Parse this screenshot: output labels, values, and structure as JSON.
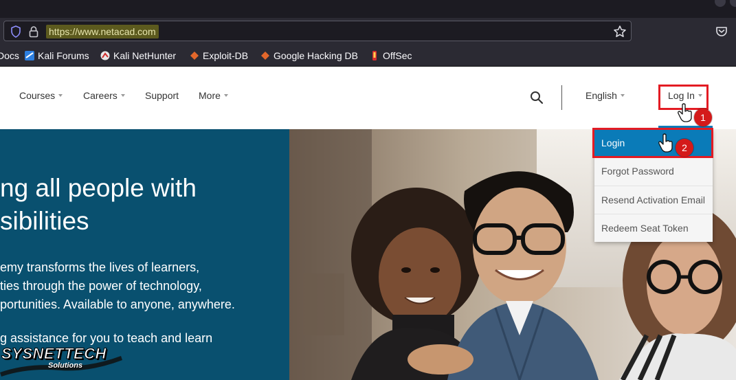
{
  "browser": {
    "url": "https://www.netacad.com",
    "bookmarks": [
      {
        "label": "Docs",
        "icon": "docs-icon"
      },
      {
        "label": "Kali Forums",
        "icon": "kali-forums-icon"
      },
      {
        "label": "Kali NetHunter",
        "icon": "kali-nethunter-icon"
      },
      {
        "label": "Exploit-DB",
        "icon": "exploit-db-icon"
      },
      {
        "label": "Google Hacking DB",
        "icon": "ghdb-icon"
      },
      {
        "label": "OffSec",
        "icon": "offsec-icon"
      }
    ]
  },
  "header": {
    "nav": [
      {
        "label": "Courses",
        "has_caret": true
      },
      {
        "label": "Careers",
        "has_caret": true
      },
      {
        "label": "Support",
        "has_caret": false
      },
      {
        "label": "More",
        "has_caret": true
      }
    ],
    "language": "English",
    "login": "Log In"
  },
  "hero": {
    "title": "ng all people with\nsibilities",
    "body": "emy transforms the lives of learners,\nties through the power of technology,\nportunities. Available to anyone, anywhere.",
    "body2": "g assistance for you to teach and learn"
  },
  "login_menu": {
    "items": [
      "Login",
      "Forgot Password",
      "Resend Activation Email",
      "Redeem Seat Token"
    ],
    "active_index": 0
  },
  "annotations": {
    "step1": "1",
    "step2": "2"
  },
  "watermark": {
    "brand": "SYSNETTECH",
    "sub": "Solutions"
  },
  "colors": {
    "hero_bg": "#09506f",
    "accent": "#0a7bb8",
    "annotation_red": "#e31b23"
  }
}
